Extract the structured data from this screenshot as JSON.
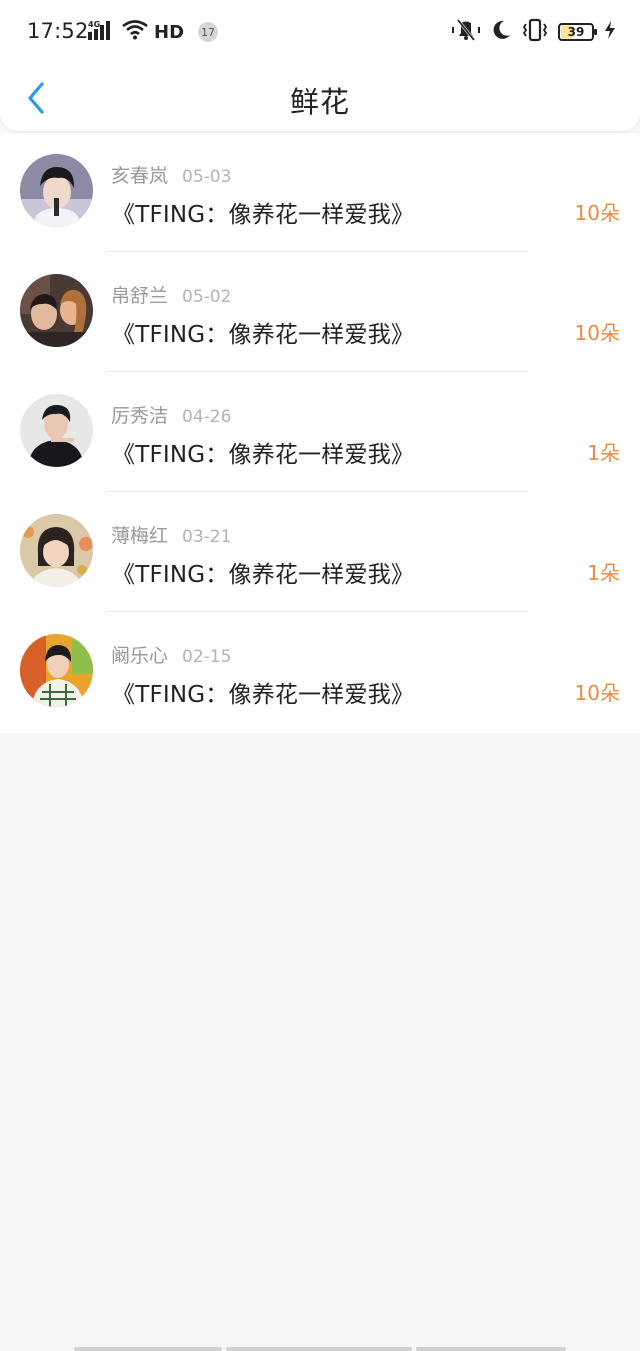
{
  "status_bar": {
    "time": "17:52",
    "network": "4G",
    "hd": "HD",
    "notification_count": "17",
    "battery": "39",
    "icons": [
      "signal-icon",
      "wifi-icon",
      "mute-icon",
      "moon-icon",
      "vibrate-icon",
      "battery-icon",
      "charging-icon"
    ]
  },
  "header": {
    "title": "鲜花",
    "back_icon": "chevron-left-icon"
  },
  "colors": {
    "accent": "#2a9ae8",
    "count": "#ef8a45"
  },
  "items": [
    {
      "name": "亥春岚",
      "date": "05-03",
      "song": "《TFING：像养花一样爱我》",
      "count": "10朵"
    },
    {
      "name": "帛舒兰",
      "date": "05-02",
      "song": "《TFING：像养花一样爱我》",
      "count": "10朵"
    },
    {
      "name": "厉秀洁",
      "date": "04-26",
      "song": "《TFING：像养花一样爱我》",
      "count": "1朵"
    },
    {
      "name": "薄梅红",
      "date": "03-21",
      "song": "《TFING：像养花一样爱我》",
      "count": "1朵"
    },
    {
      "name": "阚乐心",
      "date": "02-15",
      "song": "《TFING：像养花一样爱我》",
      "count": "10朵"
    }
  ]
}
